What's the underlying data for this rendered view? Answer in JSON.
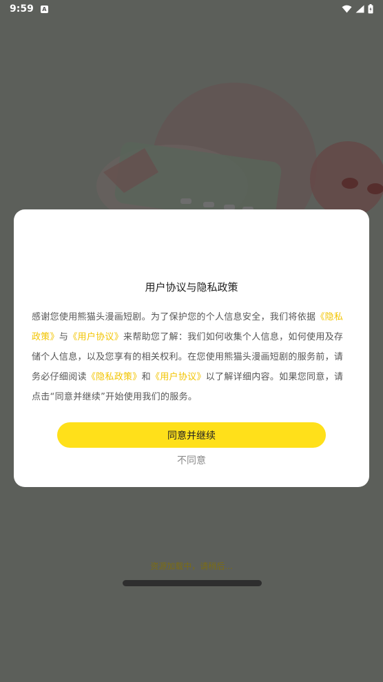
{
  "status_bar": {
    "time": "9:59",
    "notification_icon": "a-icon",
    "icons": [
      "wifi-icon",
      "signal-icon",
      "battery-icon"
    ]
  },
  "dialog": {
    "title": "用户协议与隐私政策",
    "body": [
      {
        "text": "感谢您使用熊猫头漫画短剧。为了保护您的个人信息安全，我们将依据",
        "link": false
      },
      {
        "text": "《隐私政策》",
        "link": true
      },
      {
        "text": "与",
        "link": false
      },
      {
        "text": "《用户协议》",
        "link": true
      },
      {
        "text": "来帮助您了解：我们如何收集个人信息，如何使用及存储个人信息，以及您享有的相关权利。在您使用熊猫头漫画短剧的服务前，请务必仔细阅读",
        "link": false
      },
      {
        "text": "《隐私政策》",
        "link": true
      },
      {
        "text": "和",
        "link": false
      },
      {
        "text": "《用户协议》",
        "link": true
      },
      {
        "text": "以了解详细内容。如果您同意，请点击“同意并继续”开始使用我们的服务。",
        "link": false
      }
    ],
    "agree_label": "同意并继续",
    "disagree_label": "不同意",
    "icon": "shield-lock-icon"
  },
  "loading_text": "资源加载中，请稍后...",
  "colors": {
    "accent": "#ffe01a",
    "link": "#f2c400",
    "overlay": "rgba(40,40,40,0.68)"
  }
}
